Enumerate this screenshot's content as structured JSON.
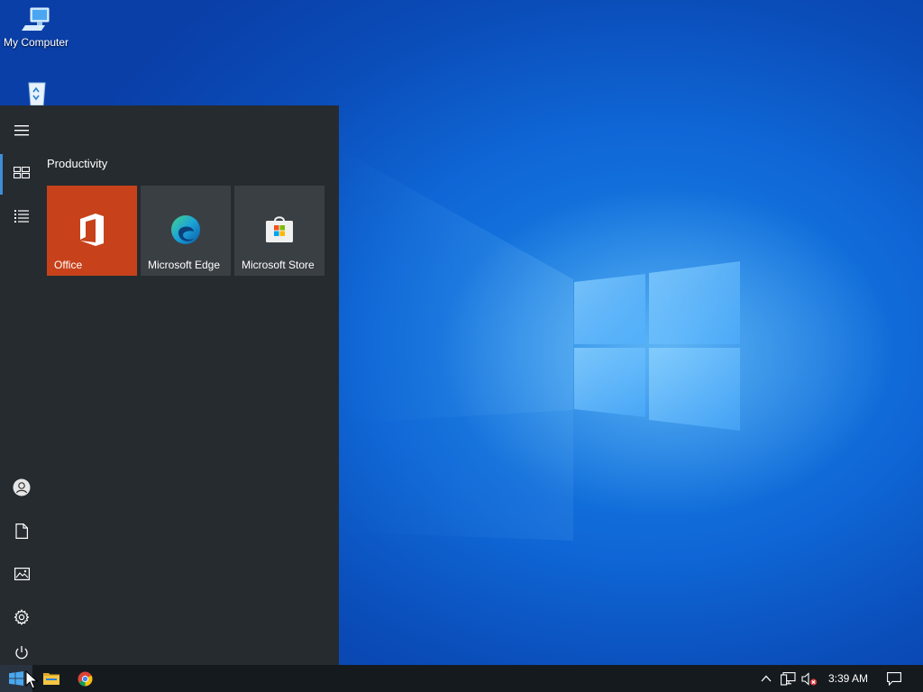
{
  "desktop": {
    "icons": [
      {
        "label": "My Computer",
        "icon": "computer-icon"
      },
      {
        "label": "",
        "icon": "recycle-bin-icon"
      }
    ]
  },
  "start_menu": {
    "group_title": "Productivity",
    "rail": {
      "top": [
        {
          "name": "expand",
          "icon": "hamburger-icon"
        },
        {
          "name": "pinned-tiles",
          "icon": "tiles-icon",
          "active": true
        },
        {
          "name": "all-apps",
          "icon": "list-icon"
        }
      ],
      "bottom": [
        {
          "name": "user",
          "icon": "user-icon"
        },
        {
          "name": "documents",
          "icon": "document-icon"
        },
        {
          "name": "pictures",
          "icon": "pictures-icon"
        },
        {
          "name": "settings",
          "icon": "gear-icon"
        },
        {
          "name": "power",
          "icon": "power-icon"
        }
      ]
    },
    "tiles": [
      {
        "label": "Office",
        "icon": "office-icon",
        "color": "#c7421b"
      },
      {
        "label": "Microsoft Edge",
        "icon": "edge-icon",
        "color": "#3a3f44"
      },
      {
        "label": "Microsoft Store",
        "icon": "store-icon",
        "color": "#3a3f44"
      }
    ]
  },
  "taskbar": {
    "pinned": [
      {
        "name": "start",
        "icon": "windows-logo-icon"
      },
      {
        "name": "file-explorer",
        "icon": "folder-icon"
      },
      {
        "name": "chrome",
        "icon": "chrome-icon"
      }
    ],
    "tray": {
      "clock": "3:39 AM",
      "icons": [
        "chevron-up-icon",
        "network-icon",
        "volume-muted-icon",
        "notification-icon"
      ]
    }
  },
  "colors": {
    "accent": "#3e8ed8",
    "start_bg": "#262b30",
    "taskbar_bg": "#151a1f",
    "office_tile": "#c7421b"
  }
}
